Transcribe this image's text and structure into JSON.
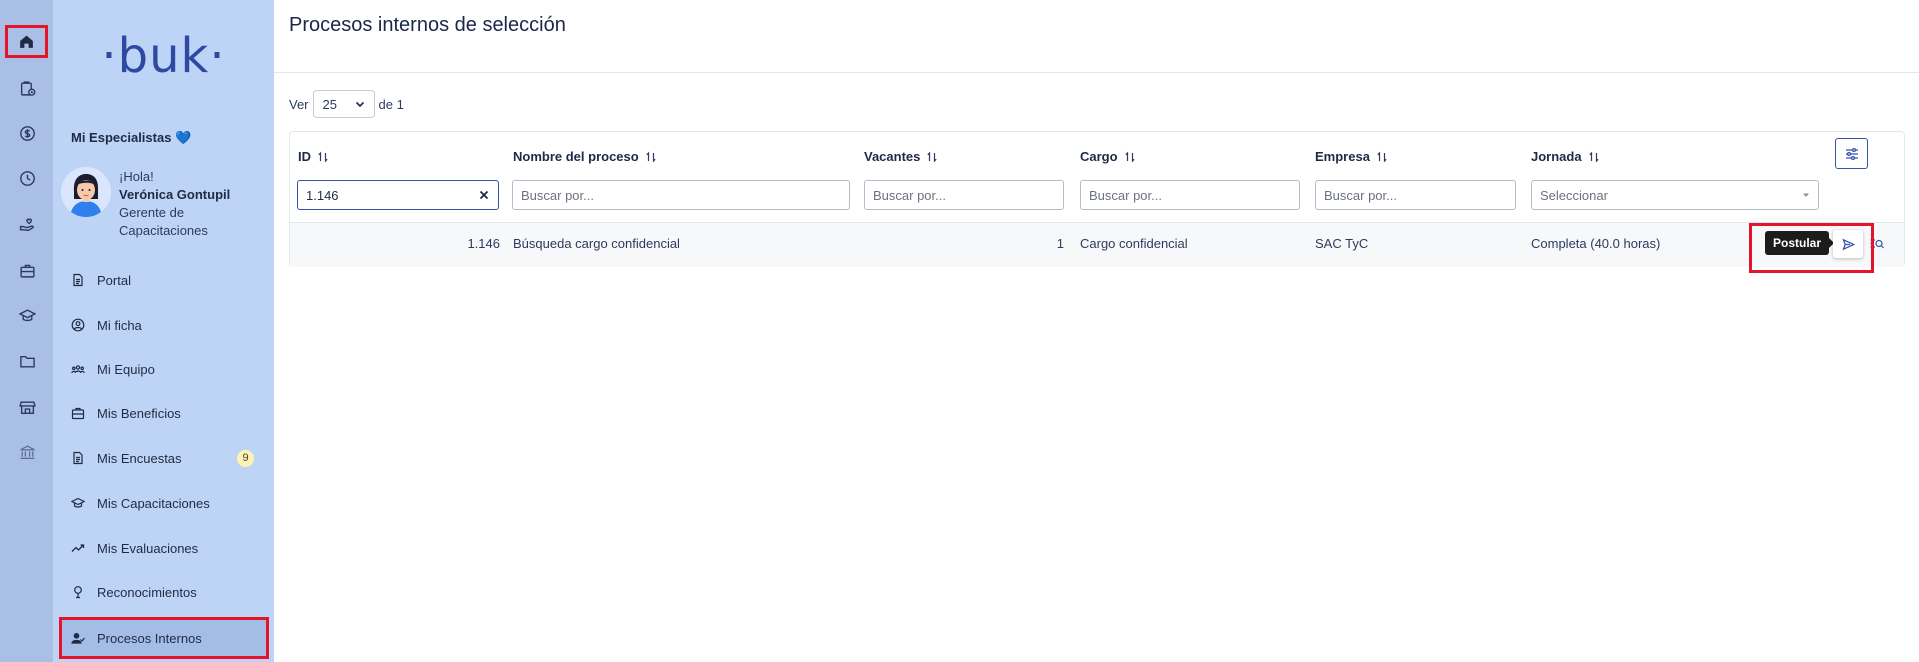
{
  "brand": {
    "logo_text": "·buk·",
    "accent": "#3752a8",
    "highlight": "#e4152b"
  },
  "rail": {
    "icons": [
      "home-icon",
      "clipboard-clock-icon",
      "dollar-icon",
      "clock-icon",
      "hand-heart-icon",
      "briefcase-icon",
      "graduation-cap-icon",
      "folder-icon",
      "store-icon",
      "bank-icon"
    ]
  },
  "sidebar": {
    "team_label": "Mi Especialistas 💙",
    "greeting": "¡Hola!",
    "user_name": "Verónica Gontupil",
    "user_role": "Gerente de Capacitaciones",
    "items": [
      {
        "label": "Portal",
        "icon": "document-icon"
      },
      {
        "label": "Mi ficha",
        "icon": "user-circle-icon"
      },
      {
        "label": "Mi Equipo",
        "icon": "team-icon"
      },
      {
        "label": "Mis Beneficios",
        "icon": "gift-icon"
      },
      {
        "label": "Mis Encuestas",
        "icon": "survey-icon",
        "badge": "9"
      },
      {
        "label": "Mis Capacitaciones",
        "icon": "graduation-cap-icon"
      },
      {
        "label": "Mis Evaluaciones",
        "icon": "trend-icon"
      },
      {
        "label": "Reconocimientos",
        "icon": "trophy-icon"
      },
      {
        "label": "Procesos Internos",
        "icon": "user-check-icon",
        "active": true
      }
    ]
  },
  "main": {
    "title": "Procesos internos de selección",
    "pagination": {
      "prefix": "Ver",
      "per_page": "25",
      "suffix": "de 1"
    },
    "columns": [
      {
        "label": "ID",
        "filter_value": "1.146"
      },
      {
        "label": "Nombre del proceso",
        "filter_placeholder": "Buscar por..."
      },
      {
        "label": "Vacantes",
        "filter_placeholder": "Buscar por..."
      },
      {
        "label": "Cargo",
        "filter_placeholder": "Buscar por..."
      },
      {
        "label": "Empresa",
        "filter_placeholder": "Buscar por..."
      },
      {
        "label": "Jornada",
        "filter_placeholder": "Seleccionar"
      }
    ],
    "rows": [
      {
        "id": "1.146",
        "nombre": "Búsqueda cargo confidencial",
        "vacantes": "1",
        "cargo": "Cargo confidencial",
        "empresa": "SAC TyC",
        "jornada": "Completa (40.0 horas)"
      }
    ],
    "tooltip": "Postular"
  }
}
